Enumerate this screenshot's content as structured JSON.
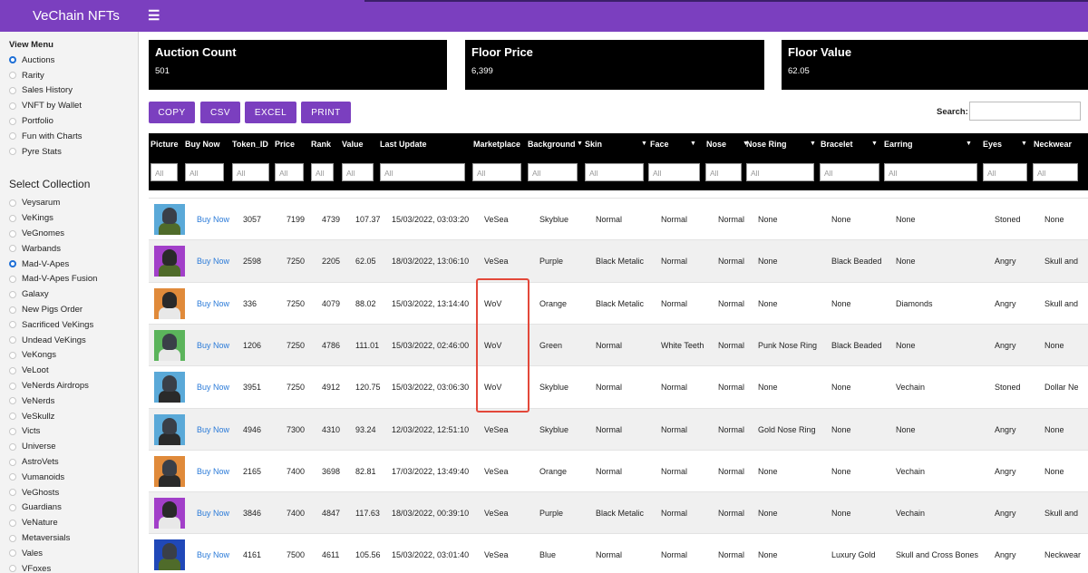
{
  "header": {
    "title": "VeChain NFTs",
    "menu_icon": "☰"
  },
  "sidebar": {
    "view_menu_title": "View Menu",
    "view_items": [
      {
        "label": "Auctions",
        "selected": true
      },
      {
        "label": "Rarity",
        "selected": false
      },
      {
        "label": "Sales History",
        "selected": false
      },
      {
        "label": "VNFT by Wallet",
        "selected": false
      },
      {
        "label": "Portfolio",
        "selected": false
      },
      {
        "label": "Fun with Charts",
        "selected": false
      },
      {
        "label": "Pyre Stats",
        "selected": false
      }
    ],
    "collection_title": "Select Collection",
    "collections": [
      {
        "label": "Veysarum",
        "selected": false
      },
      {
        "label": "VeKings",
        "selected": false
      },
      {
        "label": "VeGnomes",
        "selected": false
      },
      {
        "label": "Warbands",
        "selected": false
      },
      {
        "label": "Mad-V-Apes",
        "selected": true
      },
      {
        "label": "Mad-V-Apes Fusion",
        "selected": false
      },
      {
        "label": "Galaxy",
        "selected": false
      },
      {
        "label": "New Pigs Order",
        "selected": false
      },
      {
        "label": "Sacrificed VeKings",
        "selected": false
      },
      {
        "label": "Undead VeKings",
        "selected": false
      },
      {
        "label": "VeKongs",
        "selected": false
      },
      {
        "label": "VeLoot",
        "selected": false
      },
      {
        "label": "VeNerds Airdrops",
        "selected": false
      },
      {
        "label": "VeNerds",
        "selected": false
      },
      {
        "label": "VeSkullz",
        "selected": false
      },
      {
        "label": "Victs",
        "selected": false
      },
      {
        "label": "Universe",
        "selected": false
      },
      {
        "label": "AstroVets",
        "selected": false
      },
      {
        "label": "Vumanoids",
        "selected": false
      },
      {
        "label": "VeGhosts",
        "selected": false
      },
      {
        "label": "Guardians",
        "selected": false
      },
      {
        "label": "VeNature",
        "selected": false
      },
      {
        "label": "Metaversials",
        "selected": false
      },
      {
        "label": "Vales",
        "selected": false
      },
      {
        "label": "VFoxes",
        "selected": false
      }
    ]
  },
  "stats": {
    "auction_count": {
      "label": "Auction Count",
      "value": "501"
    },
    "floor_price": {
      "label": "Floor Price",
      "value": "6,399"
    },
    "floor_value": {
      "label": "Floor Value",
      "value": "62.05"
    }
  },
  "toolbar": {
    "copy": "COPY",
    "csv": "CSV",
    "excel": "EXCEL",
    "print": "PRINT",
    "search_label": "Search:"
  },
  "table": {
    "filter_placeholder": "All",
    "columns": [
      "Picture",
      "Buy Now",
      "Token_ID",
      "Price",
      "Rank",
      "Value",
      "Last Update",
      "Marketplace",
      "Background",
      "Skin",
      "Face",
      "Nose",
      "Nose Ring",
      "Bracelet",
      "Earring",
      "Eyes",
      "Neckwear"
    ],
    "rows": [
      {
        "buy": "Buy Now",
        "token": "3057",
        "price": "7199",
        "rank": "4739",
        "value": "107.37",
        "updated": "15/03/2022, 03:03:20",
        "market": "VeSea",
        "background": "Skyblue",
        "skin": "Normal",
        "face": "Normal",
        "nose": "Normal",
        "nose_ring": "None",
        "bracelet": "None",
        "earring": "None",
        "eyes": "Stoned",
        "neckwear": "None",
        "thumb_bg": "#5aa9d8",
        "fur": "#3a3f48",
        "shirt": "#4f6b2a"
      },
      {
        "buy": "Buy Now",
        "token": "2598",
        "price": "7250",
        "rank": "2205",
        "value": "62.05",
        "updated": "18/03/2022, 13:06:10",
        "market": "VeSea",
        "background": "Purple",
        "skin": "Black Metalic",
        "face": "Normal",
        "nose": "Normal",
        "nose_ring": "None",
        "bracelet": "Black Beaded",
        "earring": "None",
        "eyes": "Angry",
        "neckwear": "Skull and",
        "thumb_bg": "#a23fc9",
        "fur": "#2a2a2a",
        "shirt": "#4f6b2a"
      },
      {
        "buy": "Buy Now",
        "token": "336",
        "price": "7250",
        "rank": "4079",
        "value": "88.02",
        "updated": "15/03/2022, 13:14:40",
        "market": "WoV",
        "background": "Orange",
        "skin": "Black Metalic",
        "face": "Normal",
        "nose": "Normal",
        "nose_ring": "None",
        "bracelet": "None",
        "earring": "Diamonds",
        "eyes": "Angry",
        "neckwear": "Skull and",
        "thumb_bg": "#e08a3a",
        "fur": "#2a2a2a",
        "shirt": "#e8e8e8"
      },
      {
        "buy": "Buy Now",
        "token": "1206",
        "price": "7250",
        "rank": "4786",
        "value": "111.01",
        "updated": "15/03/2022, 02:46:00",
        "market": "WoV",
        "background": "Green",
        "skin": "Normal",
        "face": "White Teeth",
        "nose": "Normal",
        "nose_ring": "Punk Nose Ring",
        "bracelet": "Black Beaded",
        "earring": "None",
        "eyes": "Angry",
        "neckwear": "None",
        "thumb_bg": "#5bb45b",
        "fur": "#3a3f48",
        "shirt": "#e8e8e8"
      },
      {
        "buy": "Buy Now",
        "token": "3951",
        "price": "7250",
        "rank": "4912",
        "value": "120.75",
        "updated": "15/03/2022, 03:06:30",
        "market": "WoV",
        "background": "Skyblue",
        "skin": "Normal",
        "face": "Normal",
        "nose": "Normal",
        "nose_ring": "None",
        "bracelet": "None",
        "earring": "Vechain",
        "eyes": "Stoned",
        "neckwear": "Dollar Ne",
        "thumb_bg": "#5aa9d8",
        "fur": "#3a3f48",
        "shirt": "#2a2a2a"
      },
      {
        "buy": "Buy Now",
        "token": "4946",
        "price": "7300",
        "rank": "4310",
        "value": "93.24",
        "updated": "12/03/2022, 12:51:10",
        "market": "VeSea",
        "background": "Skyblue",
        "skin": "Normal",
        "face": "Normal",
        "nose": "Normal",
        "nose_ring": "Gold Nose Ring",
        "bracelet": "None",
        "earring": "None",
        "eyes": "Angry",
        "neckwear": "None",
        "thumb_bg": "#5aa9d8",
        "fur": "#3a3f48",
        "shirt": "#2a2a2a"
      },
      {
        "buy": "Buy Now",
        "token": "2165",
        "price": "7400",
        "rank": "3698",
        "value": "82.81",
        "updated": "17/03/2022, 13:49:40",
        "market": "VeSea",
        "background": "Orange",
        "skin": "Normal",
        "face": "Normal",
        "nose": "Normal",
        "nose_ring": "None",
        "bracelet": "None",
        "earring": "Vechain",
        "eyes": "Angry",
        "neckwear": "None",
        "thumb_bg": "#e08a3a",
        "fur": "#3a3f48",
        "shirt": "#2a2a2a"
      },
      {
        "buy": "Buy Now",
        "token": "3846",
        "price": "7400",
        "rank": "4847",
        "value": "117.63",
        "updated": "18/03/2022, 00:39:10",
        "market": "VeSea",
        "background": "Purple",
        "skin": "Black Metalic",
        "face": "Normal",
        "nose": "Normal",
        "nose_ring": "None",
        "bracelet": "None",
        "earring": "Vechain",
        "eyes": "Angry",
        "neckwear": "Skull and",
        "thumb_bg": "#a23fc9",
        "fur": "#2a2a2a",
        "shirt": "#e8e8e8"
      },
      {
        "buy": "Buy Now",
        "token": "4161",
        "price": "7500",
        "rank": "4611",
        "value": "105.56",
        "updated": "15/03/2022, 03:01:40",
        "market": "VeSea",
        "background": "Blue",
        "skin": "Normal",
        "face": "Normal",
        "nose": "Normal",
        "nose_ring": "None",
        "bracelet": "Luxury Gold",
        "earring": "Skull and Cross Bones",
        "eyes": "Angry",
        "neckwear": "Neckwear",
        "thumb_bg": "#2048b8",
        "fur": "#3a3f48",
        "shirt": "#4f6b2a"
      }
    ]
  }
}
